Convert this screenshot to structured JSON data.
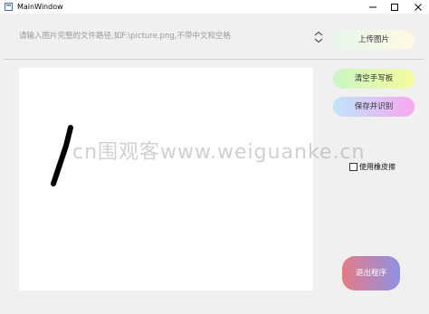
{
  "window": {
    "title": "MainWindow",
    "controls": {
      "minimize_icon": "minimize-icon",
      "maximize_icon": "maximize-icon",
      "close_icon": "close-icon"
    }
  },
  "input": {
    "placeholder": "请输入图片完整的文件路径,如F:\\picture.png,不带中文和空格",
    "value": ""
  },
  "buttons": {
    "upload": "上传图片",
    "clear": "清空手写板",
    "save_recognize": "保存并识别",
    "exit": "退出程序"
  },
  "eraser": {
    "label": "使用橡皮擦",
    "checked": false
  },
  "watermark": "cn围观客www.weiguanke.cn",
  "colors": {
    "canvas": "#ffffff",
    "window_bg": "#f0f0f0",
    "stroke": "#000000"
  }
}
